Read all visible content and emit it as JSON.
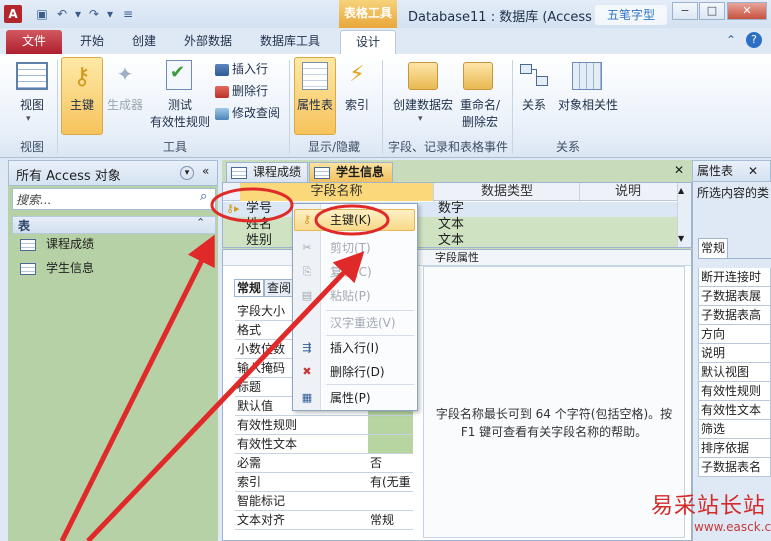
{
  "title_bar": {
    "app_icon_letter": "A",
    "table_tools": "表格工具",
    "window_title": "Database11 : 数据库 (Access",
    "watermark": "五笔字型",
    "minimize": "−",
    "restore": "□",
    "close": "✕"
  },
  "tabs": {
    "file": "文件",
    "home": "开始",
    "create": "创建",
    "external": "外部数据",
    "dbtools": "数据库工具",
    "design": "设计",
    "help": "?"
  },
  "ribbon": {
    "view": "视图",
    "primary_key": "主键",
    "builder": "生成器",
    "test_rules_1": "测试",
    "test_rules_2": "有效性规则",
    "insert_rows": "插入行",
    "delete_rows": "删除行",
    "modify_lookups": "修改查阅",
    "property_sheet": "属性表",
    "indexes": "索引",
    "create_macros": "创建数据宏",
    "rename_macro_1": "重命名/",
    "rename_macro_2": "删除宏",
    "relationships": "关系",
    "dependencies": "对象相关性",
    "groups": {
      "view": "视图",
      "tools": "工具",
      "showhide": "显示/隐藏",
      "events": "字段、记录和表格事件",
      "relations": "关系"
    }
  },
  "nav": {
    "header": "所有 Access 对象",
    "search_placeholder": "搜索...",
    "section": "表",
    "items": [
      "课程成绩",
      "学生信息"
    ]
  },
  "doc_tabs": [
    "课程成绩",
    "学生信息"
  ],
  "grid": {
    "headers": [
      "字段名称",
      "数据类型",
      "说明"
    ],
    "rows": [
      {
        "name": "学号",
        "type": "数字"
      },
      {
        "name": "姓名",
        "type": "文本"
      },
      {
        "name": "姓别",
        "type": "文本"
      }
    ]
  },
  "field_props": {
    "title": "字段属性",
    "tabs": [
      "常规",
      "查阅"
    ],
    "rows": [
      {
        "label": "字段大小",
        "value": ""
      },
      {
        "label": "格式",
        "value": ""
      },
      {
        "label": "小数位数",
        "value": ""
      },
      {
        "label": "输入掩码",
        "value": ""
      },
      {
        "label": "标题",
        "value": ""
      },
      {
        "label": "默认值",
        "value": ""
      },
      {
        "label": "有效性规则",
        "value": ""
      },
      {
        "label": "有效性文本",
        "value": ""
      },
      {
        "label": "必需",
        "value": "否"
      },
      {
        "label": "索引",
        "value": "有(无重"
      },
      {
        "label": "智能标记",
        "value": ""
      },
      {
        "label": "文本对齐",
        "value": "常规"
      }
    ],
    "help": "字段名称最长可到 64 个字符(包括空格)。按 F1 键可查看有关字段名称的帮助。"
  },
  "property_sheet": {
    "title": "属性表",
    "subtitle": "所选内容的类",
    "tab": "常规",
    "rows": [
      "断开连接时",
      "子数据表展",
      "子数据表高",
      "方向",
      "说明",
      "默认视图",
      "有效性规则",
      "有效性文本",
      "筛选",
      "排序依据",
      "子数据表名"
    ]
  },
  "context_menu": {
    "items": [
      {
        "label": "主键(K)",
        "enabled": true
      },
      {
        "label": "剪切(T)",
        "enabled": false
      },
      {
        "label": "复制(C)",
        "enabled": false
      },
      {
        "label": "粘贴(P)",
        "enabled": false
      },
      {
        "label": "汉字重选(V)",
        "enabled": false
      },
      {
        "label": "插入行(I)",
        "enabled": true
      },
      {
        "label": "删除行(D)",
        "enabled": true
      },
      {
        "label": "属性(P)",
        "enabled": true
      }
    ]
  },
  "watermark_bottom": {
    "brand": "易采站长站",
    "url": "www.easck.com"
  },
  "colors": {
    "accent_red": "#d32a2a",
    "ribbon_active": "#f7c35d",
    "nav_green": "#b7d1a6"
  }
}
